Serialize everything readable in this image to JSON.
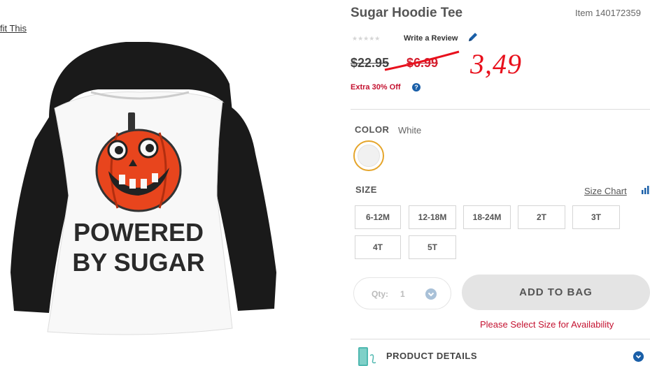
{
  "outfit_link": "fit This",
  "product": {
    "title": "Sugar Hoodie Tee",
    "item_number": "Item 140172359",
    "rating_stars": "★★★★★",
    "write_review": "Write a Review",
    "price_original": "$22.95",
    "price_sale": "$6.99",
    "handwritten_price": "3,49",
    "promo": "Extra 30% Off",
    "help_glyph": "?",
    "shirt_text_line1": "POWERED",
    "shirt_text_line2": "BY SUGAR"
  },
  "color": {
    "label": "COLOR",
    "value": "White"
  },
  "size": {
    "label": "SIZE",
    "chart_link": "Size Chart",
    "options": [
      "6-12M",
      "12-18M",
      "18-24M",
      "2T",
      "3T",
      "4T",
      "5T"
    ]
  },
  "quantity": {
    "label": "Qty:",
    "value": "1"
  },
  "add_to_bag": "ADD TO BAG",
  "availability_message": "Please Select Size for Availability",
  "product_details": {
    "label": "PRODUCT DETAILS"
  },
  "colors": {
    "accent_red": "#c41230",
    "brand_blue": "#1a5fa8",
    "swatch_selected_border": "#e5a52b",
    "handwritten_red": "#e8101c"
  },
  "icons": [
    "pencil-icon",
    "help-icon",
    "size-chart-icon",
    "chevron-down-icon",
    "product-details-icon"
  ]
}
